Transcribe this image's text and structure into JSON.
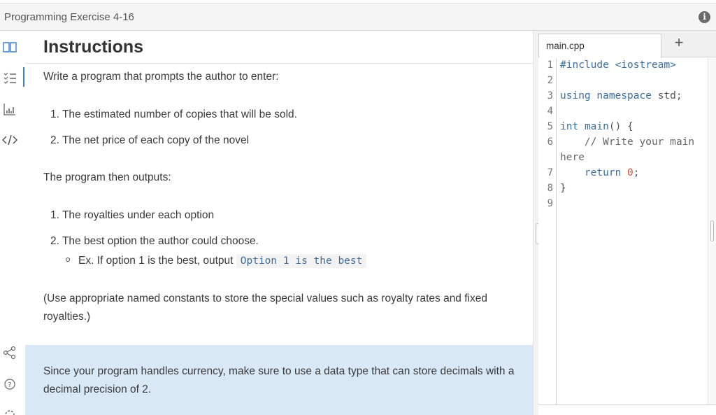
{
  "window": {
    "title": "Programming Exercise 4-16",
    "info_icon": "info-icon"
  },
  "sidebar": {
    "icons": [
      "book-icon",
      "list-icon",
      "chart-icon",
      "code-icon",
      "share-icon",
      "help-icon",
      "settings-icon"
    ]
  },
  "instructions": {
    "heading": "Instructions",
    "intro": "Write a program that prompts the author to enter:",
    "inputs": [
      "1. The estimated number of copies that will be sold.",
      "2. The net price of each copy of the novel"
    ],
    "outputs_intro": "The program then outputs:",
    "outputs": [
      "1. The royalties under each option",
      "2. The best option the author could choose."
    ],
    "example_text": "Ex. If option 1 is the best, output",
    "example_code": "Option 1 is the best",
    "constants_note": "(Use appropriate named constants to store the special values such as royalty rates and fixed royalties.)",
    "tip": "Since your program handles currency, make sure to use a data type that can store decimals with a decimal precision of 2."
  },
  "editor": {
    "tab_label": "main.cpp",
    "add_tab_label": "+",
    "line_numbers": [
      "1",
      "2",
      "3",
      "4",
      "5",
      "6",
      "",
      "7",
      "8",
      "9"
    ]
  },
  "colors": {
    "accent": "#3a7bd5",
    "tip_background": "#d9e8f6",
    "code_keyword": "#3a6ea5",
    "code_number": "#d4533b"
  }
}
